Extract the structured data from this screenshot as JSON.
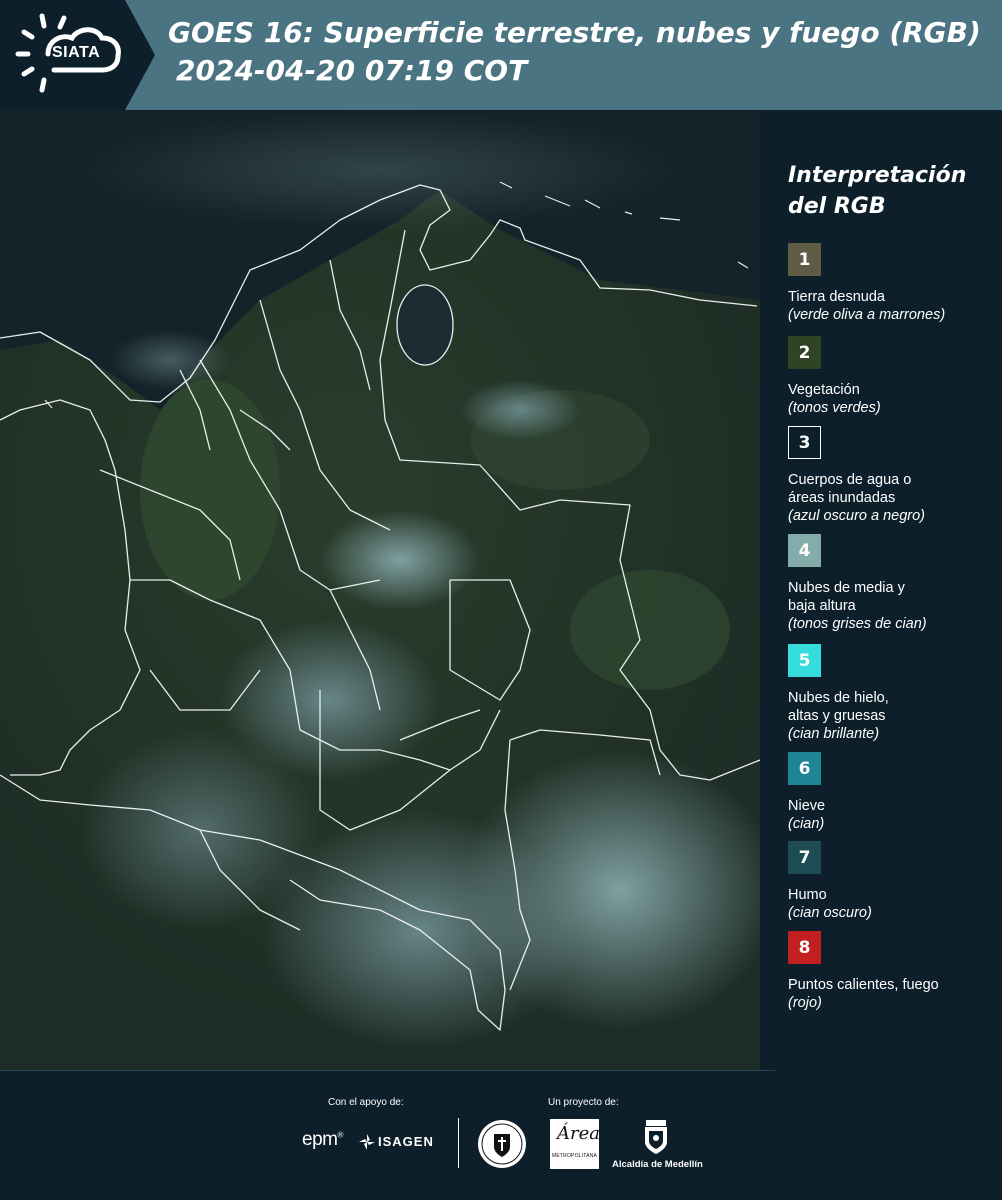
{
  "header": {
    "logo": "SIATA",
    "title_line1": "GOES 16: Superficie terrestre, nubes y fuego (RGB)",
    "title_line2": "2024-04-20 07:19 COT"
  },
  "legend": {
    "title_line1": "Interpretación",
    "title_line2": "del RGB",
    "items": [
      {
        "n": "1",
        "color": "#5e5c45",
        "border": "#5e5c45",
        "label": [
          "Tierra desnuda"
        ],
        "sub": "(verde oliva a marrones)"
      },
      {
        "n": "2",
        "color": "#2f4424",
        "border": "#2f4424",
        "label": [
          "Vegetación"
        ],
        "sub": "(tonos verdes)"
      },
      {
        "n": "3",
        "color": "#0d1f2b",
        "border": "#ffffff",
        "label": [
          "Cuerpos de agua o",
          "áreas inundadas"
        ],
        "sub": "(azul oscuro a negro)"
      },
      {
        "n": "4",
        "color": "#84acaa",
        "border": "#84acaa",
        "label": [
          "Nubes de media y",
          "baja altura"
        ],
        "sub": "(tonos grises de cian)"
      },
      {
        "n": "5",
        "color": "#35dcdc",
        "border": "#35dcdc",
        "label": [
          "Nubes de hielo,",
          "altas y gruesas"
        ],
        "sub": "(cian brillante)"
      },
      {
        "n": "6",
        "color": "#1f8496",
        "border": "#1f8496",
        "label": [
          "Nieve"
        ],
        "sub": "(cian)"
      },
      {
        "n": "7",
        "color": "#1d4c54",
        "border": "#1d4c54",
        "label": [
          "Humo"
        ],
        "sub": "(cian oscuro)"
      },
      {
        "n": "8",
        "color": "#c11f20",
        "border": "#c11f20",
        "label": [
          "Puntos calientes, fuego"
        ],
        "sub": "(rojo)"
      }
    ]
  },
  "footer": {
    "support_label": "Con el apoyo de:",
    "project_label": "Un proyecto de:",
    "epm": "epm",
    "isagen": "ISAGEN",
    "area_script": "Área",
    "area_meta": "METROPOLITANA",
    "alcaldia": "Alcaldía de Medellín"
  }
}
